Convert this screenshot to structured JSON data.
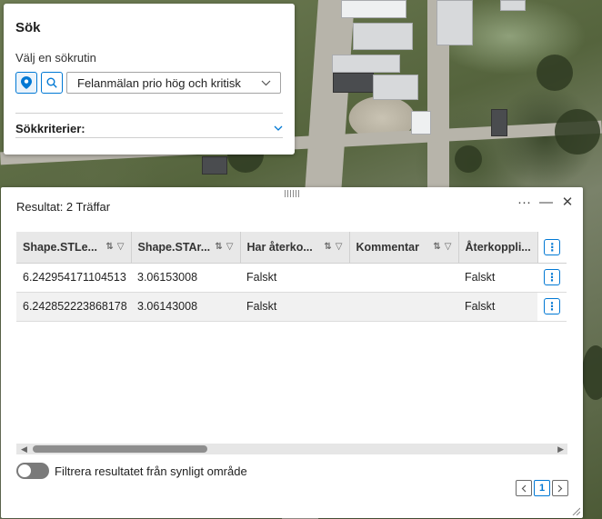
{
  "search": {
    "title": "Sök",
    "choose_label": "Välj en sökrutin",
    "selected_routine": "Felanmälan prio hög och kritisk",
    "criteria_label": "Sökkriterier:"
  },
  "results": {
    "title": "Resultat: 2 Träffar",
    "columns": [
      "Shape.STLe...",
      "Shape.STAr...",
      "Har återko...",
      "Kommentar",
      "Återkoppli..."
    ],
    "rows": [
      [
        "6.242954171104513",
        "3.06153008",
        "Falskt",
        "",
        "Falskt"
      ],
      [
        "6.242852223868178",
        "3.06143008",
        "Falskt",
        "",
        "Falskt"
      ]
    ],
    "filter_label": "Filtrera resultatet från synligt område",
    "filter_enabled": false,
    "current_page": "1",
    "more_glyph": "⋮",
    "actions": {
      "more": "···",
      "minimize": "—",
      "close": "✕"
    }
  },
  "colors": {
    "accent": "#0078d4",
    "header_bg": "#e8e8e8",
    "alt_row_bg": "#f1f1f1"
  },
  "icons": {
    "location": "map-pin-icon",
    "search": "search-icon",
    "dropdown": "chevron-down-icon",
    "sort": "sort-icon",
    "filter": "filter-icon",
    "options": "vertical-ellipsis-icon"
  }
}
